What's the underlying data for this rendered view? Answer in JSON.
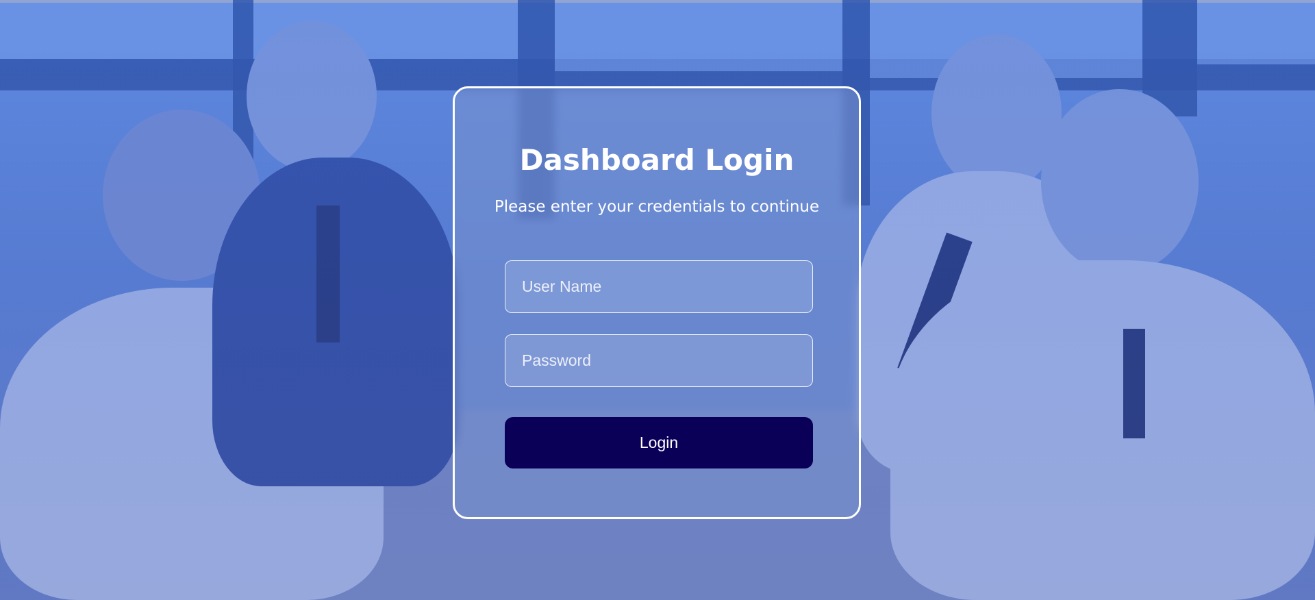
{
  "login": {
    "title": "Dashboard Login",
    "subtitle": "Please enter your credentials to continue",
    "username_placeholder": "User Name",
    "password_placeholder": "Password",
    "login_label": "Login"
  },
  "colors": {
    "button": "#0b0057",
    "card_border": "#ffffff",
    "background_tint": "#5f86d6"
  }
}
